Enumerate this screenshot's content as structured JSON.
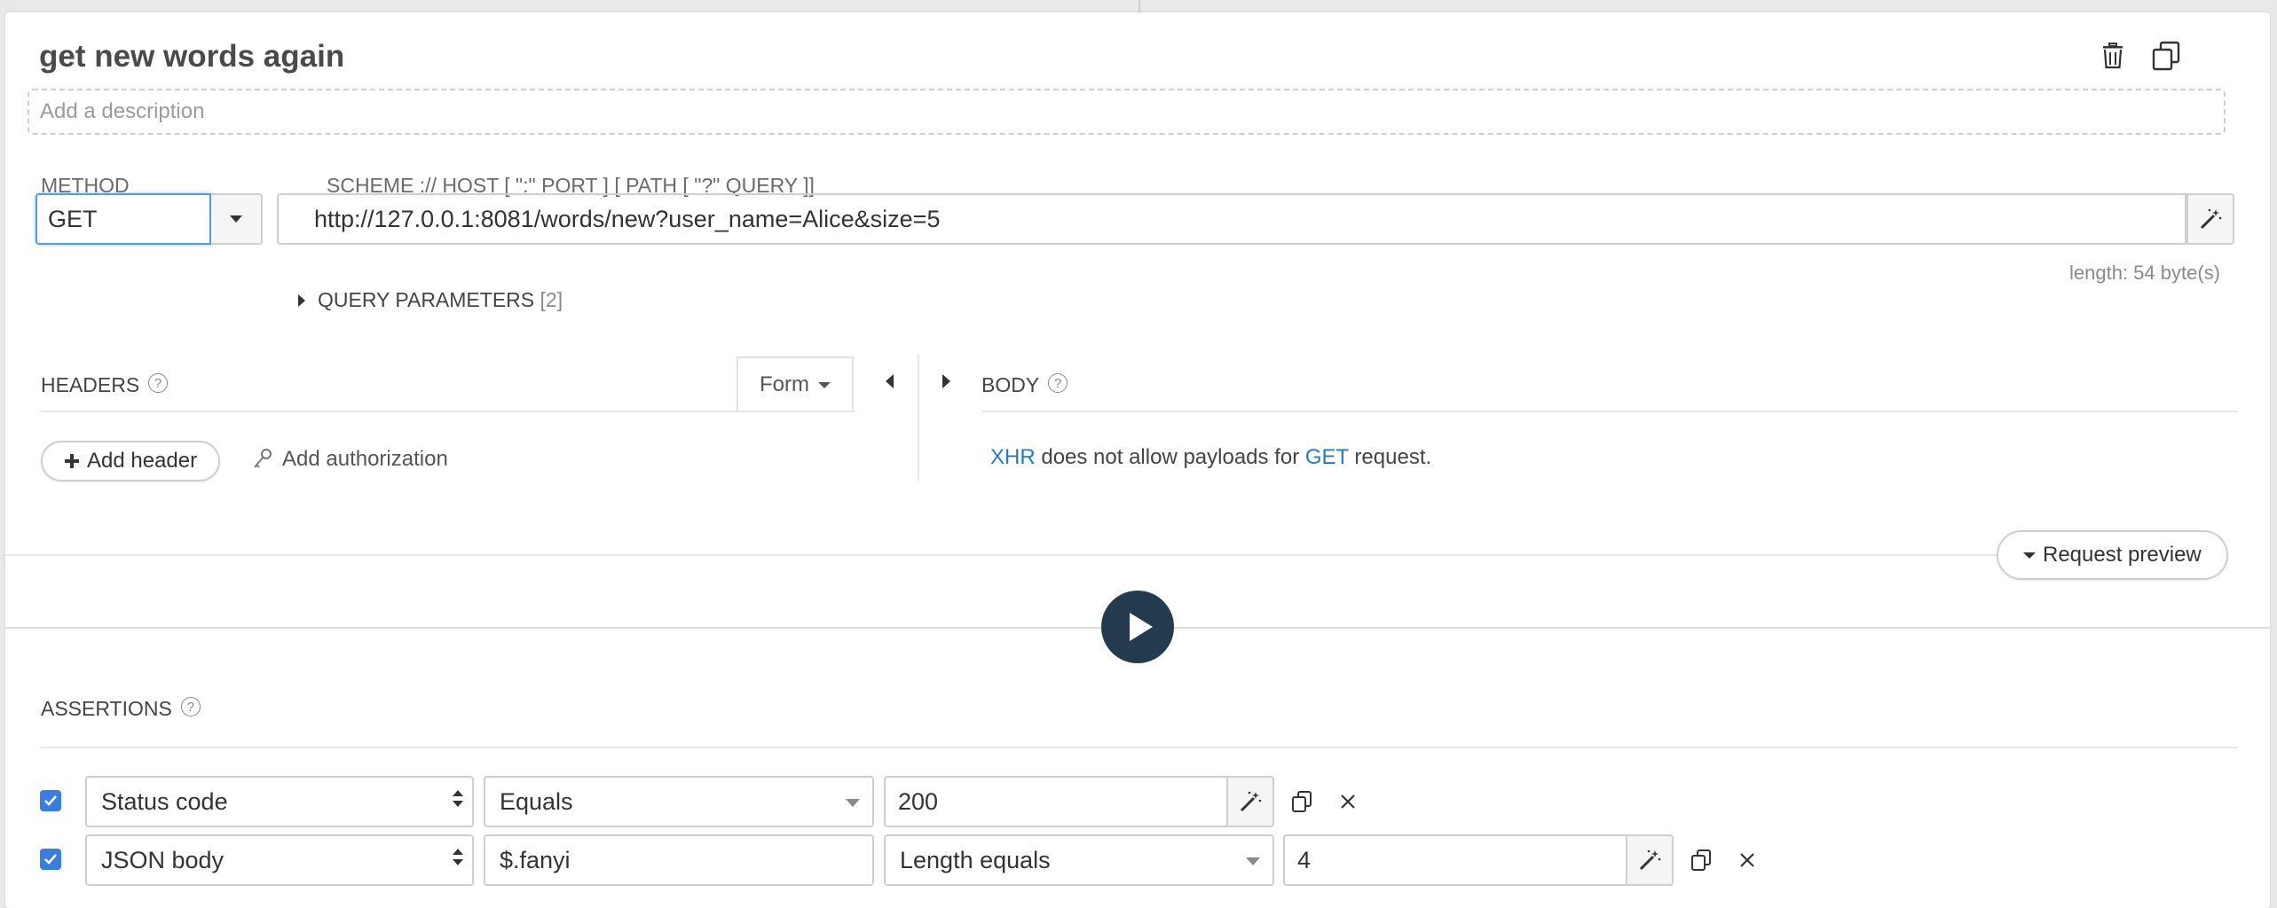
{
  "request": {
    "title": "get new words again",
    "description_placeholder": "Add a description",
    "method_label": "METHOD",
    "method_value": "GET",
    "url_label": "SCHEME :// HOST [ \":\" PORT ] [ PATH [ \"?\" QUERY ]]",
    "url_value": "http://127.0.0.1:8081/words/new?user_name=Alice&size=5",
    "length_note": "length: 54 byte(s)",
    "query_params_label": "QUERY PARAMETERS",
    "query_params_count": "[2]"
  },
  "headers": {
    "label": "HEADERS",
    "help": "?",
    "form_label": "Form",
    "add_header_label": "Add header",
    "add_auth_label": "Add authorization"
  },
  "body": {
    "label": "BODY",
    "help": "?",
    "msg_link1": "XHR",
    "msg_middle": " does not allow payloads for ",
    "msg_link2": "GET",
    "msg_end": " request."
  },
  "request_preview_label": "Request preview",
  "assertions": {
    "label": "ASSERTIONS",
    "help": "?",
    "rows": [
      {
        "checked": true,
        "source": "Status code",
        "comparison": "Equals",
        "value": "200"
      },
      {
        "checked": true,
        "source": "JSON body",
        "path": "$.fanyi",
        "comparison": "Length equals",
        "value": "4"
      }
    ]
  },
  "colors": {
    "accent": "#3b7ddd",
    "play": "#243b4f",
    "link": "#2a7ab8"
  }
}
